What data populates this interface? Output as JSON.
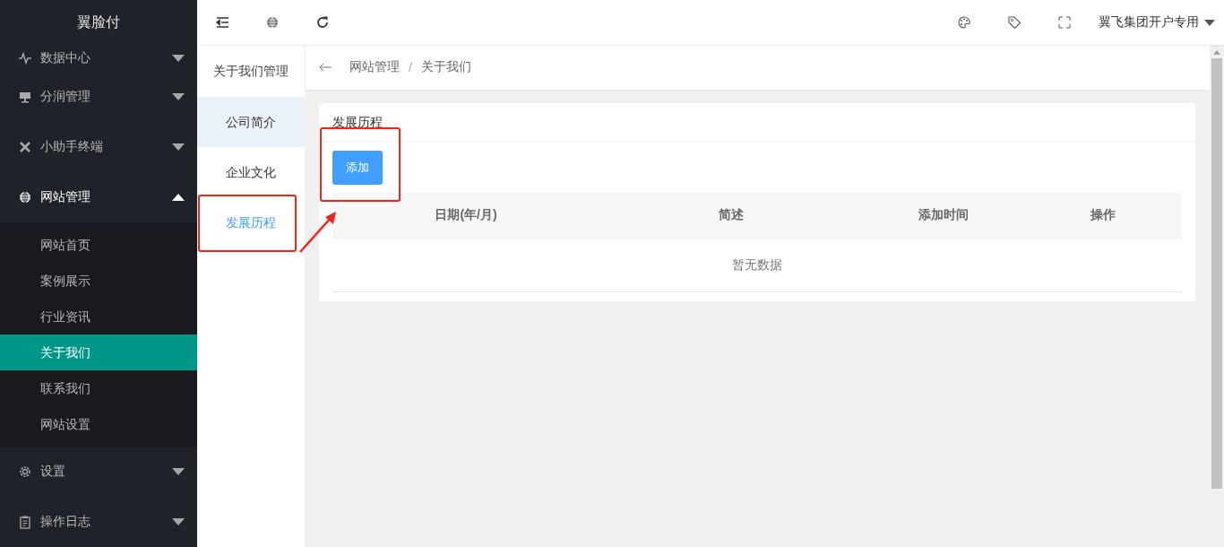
{
  "sidebar": {
    "logo": "翼脸付",
    "items": [
      {
        "label": "数据中心",
        "expanded": false,
        "selected": false
      },
      {
        "label": "分润管理",
        "expanded": false,
        "selected": false
      },
      {
        "label": "小助手终端",
        "expanded": false,
        "selected": false
      },
      {
        "label": "网站管理",
        "expanded": true,
        "selected": true,
        "children": [
          {
            "label": "网站首页",
            "selected": false
          },
          {
            "label": "案例展示",
            "selected": false
          },
          {
            "label": "行业资讯",
            "selected": false
          },
          {
            "label": "关于我们",
            "selected": true
          },
          {
            "label": "联系我们",
            "selected": false
          },
          {
            "label": "网站设置",
            "selected": false
          }
        ]
      },
      {
        "label": "设置",
        "expanded": false,
        "selected": false
      },
      {
        "label": "操作日志",
        "expanded": false,
        "selected": false
      }
    ]
  },
  "topbar": {
    "user": "翼飞集团开户专用"
  },
  "subnav": {
    "title": "关于我们管理",
    "items": [
      {
        "label": "公司简介",
        "selected": false,
        "hovered": true,
        "annotated": false
      },
      {
        "label": "企业文化",
        "selected": false,
        "hovered": false,
        "annotated": false
      },
      {
        "label": "发展历程",
        "selected": true,
        "hovered": false,
        "annotated": true
      }
    ]
  },
  "breadcrumb": {
    "items": [
      "网站管理",
      "关于我们"
    ],
    "separator": "/"
  },
  "card": {
    "title": "发展历程",
    "add_button": {
      "label": "添加",
      "annotated": true
    },
    "table": {
      "columns": [
        "日期(年/月)",
        "简述",
        "添加时间",
        "操作"
      ],
      "empty_text": "暂无数据"
    }
  }
}
